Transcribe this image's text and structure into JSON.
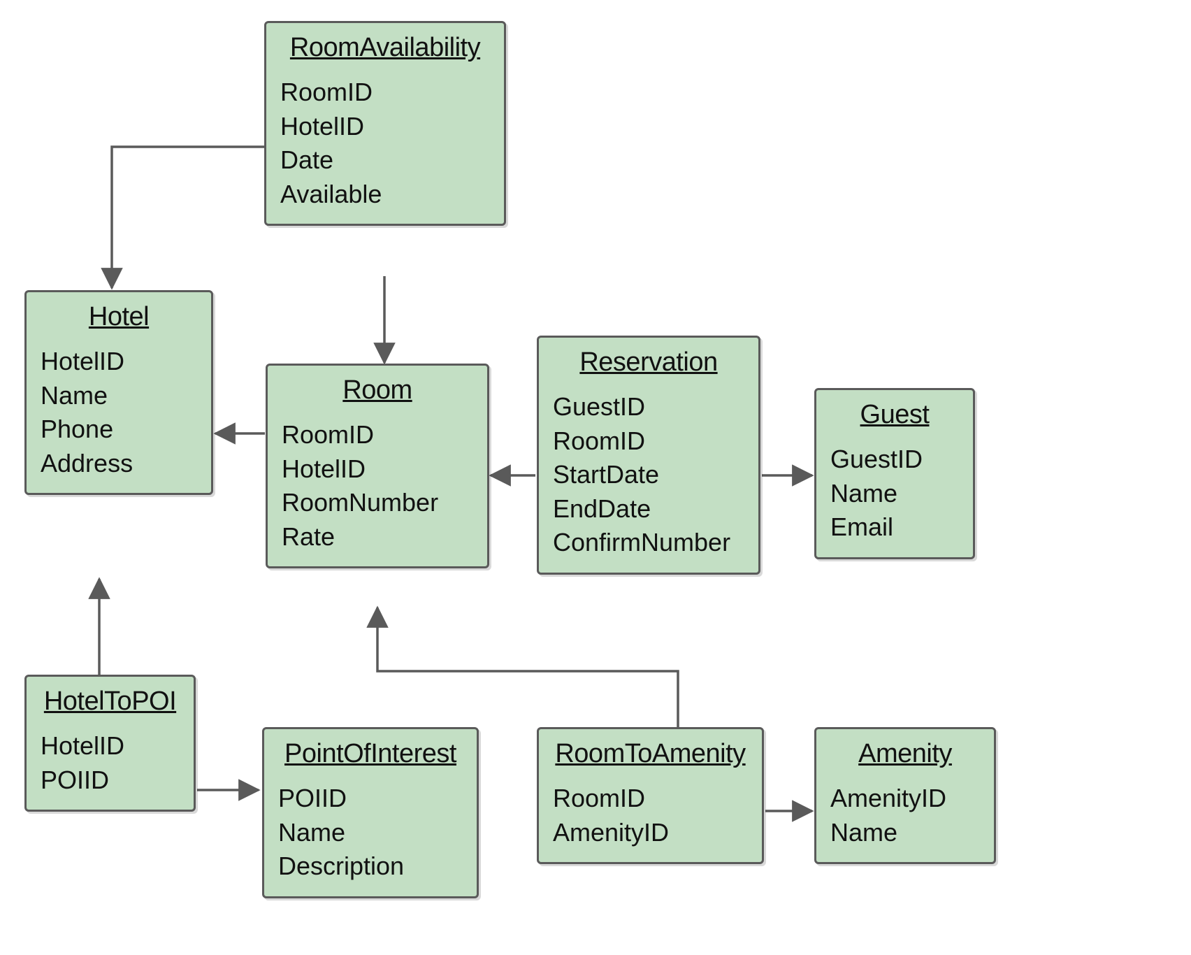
{
  "entities": {
    "roomAvailability": {
      "title": "RoomAvailability",
      "fields": [
        "RoomID",
        "HotelID",
        "Date",
        "Available"
      ]
    },
    "hotel": {
      "title": "Hotel",
      "fields": [
        "HotelID",
        "Name",
        "Phone",
        "Address"
      ]
    },
    "room": {
      "title": "Room",
      "fields": [
        "RoomID",
        "HotelID",
        "RoomNumber",
        "Rate"
      ]
    },
    "reservation": {
      "title": "Reservation",
      "fields": [
        "GuestID",
        "RoomID",
        "StartDate",
        "EndDate",
        "ConfirmNumber"
      ]
    },
    "guest": {
      "title": "Guest",
      "fields": [
        "GuestID",
        "Name",
        "Email"
      ]
    },
    "hotelToPoi": {
      "title": "HotelToPOI",
      "fields": [
        "HotelID",
        "POIID"
      ]
    },
    "pointOfInterest": {
      "title": "PointOfInterest",
      "fields": [
        "POIID",
        "Name",
        "Description"
      ]
    },
    "roomToAmenity": {
      "title": "RoomToAmenity",
      "fields": [
        "RoomID",
        "AmenityID"
      ]
    },
    "amenity": {
      "title": "Amenity",
      "fields": [
        "AmenityID",
        "Name"
      ]
    }
  },
  "relationships": [
    {
      "from": "RoomAvailability",
      "to": "Hotel"
    },
    {
      "from": "RoomAvailability",
      "to": "Room"
    },
    {
      "from": "Room",
      "to": "Hotel"
    },
    {
      "from": "Reservation",
      "to": "Room"
    },
    {
      "from": "Reservation",
      "to": "Guest"
    },
    {
      "from": "HotelToPOI",
      "to": "Hotel"
    },
    {
      "from": "HotelToPOI",
      "to": "PointOfInterest"
    },
    {
      "from": "RoomToAmenity",
      "to": "Room"
    },
    {
      "from": "RoomToAmenity",
      "to": "Amenity"
    }
  ]
}
